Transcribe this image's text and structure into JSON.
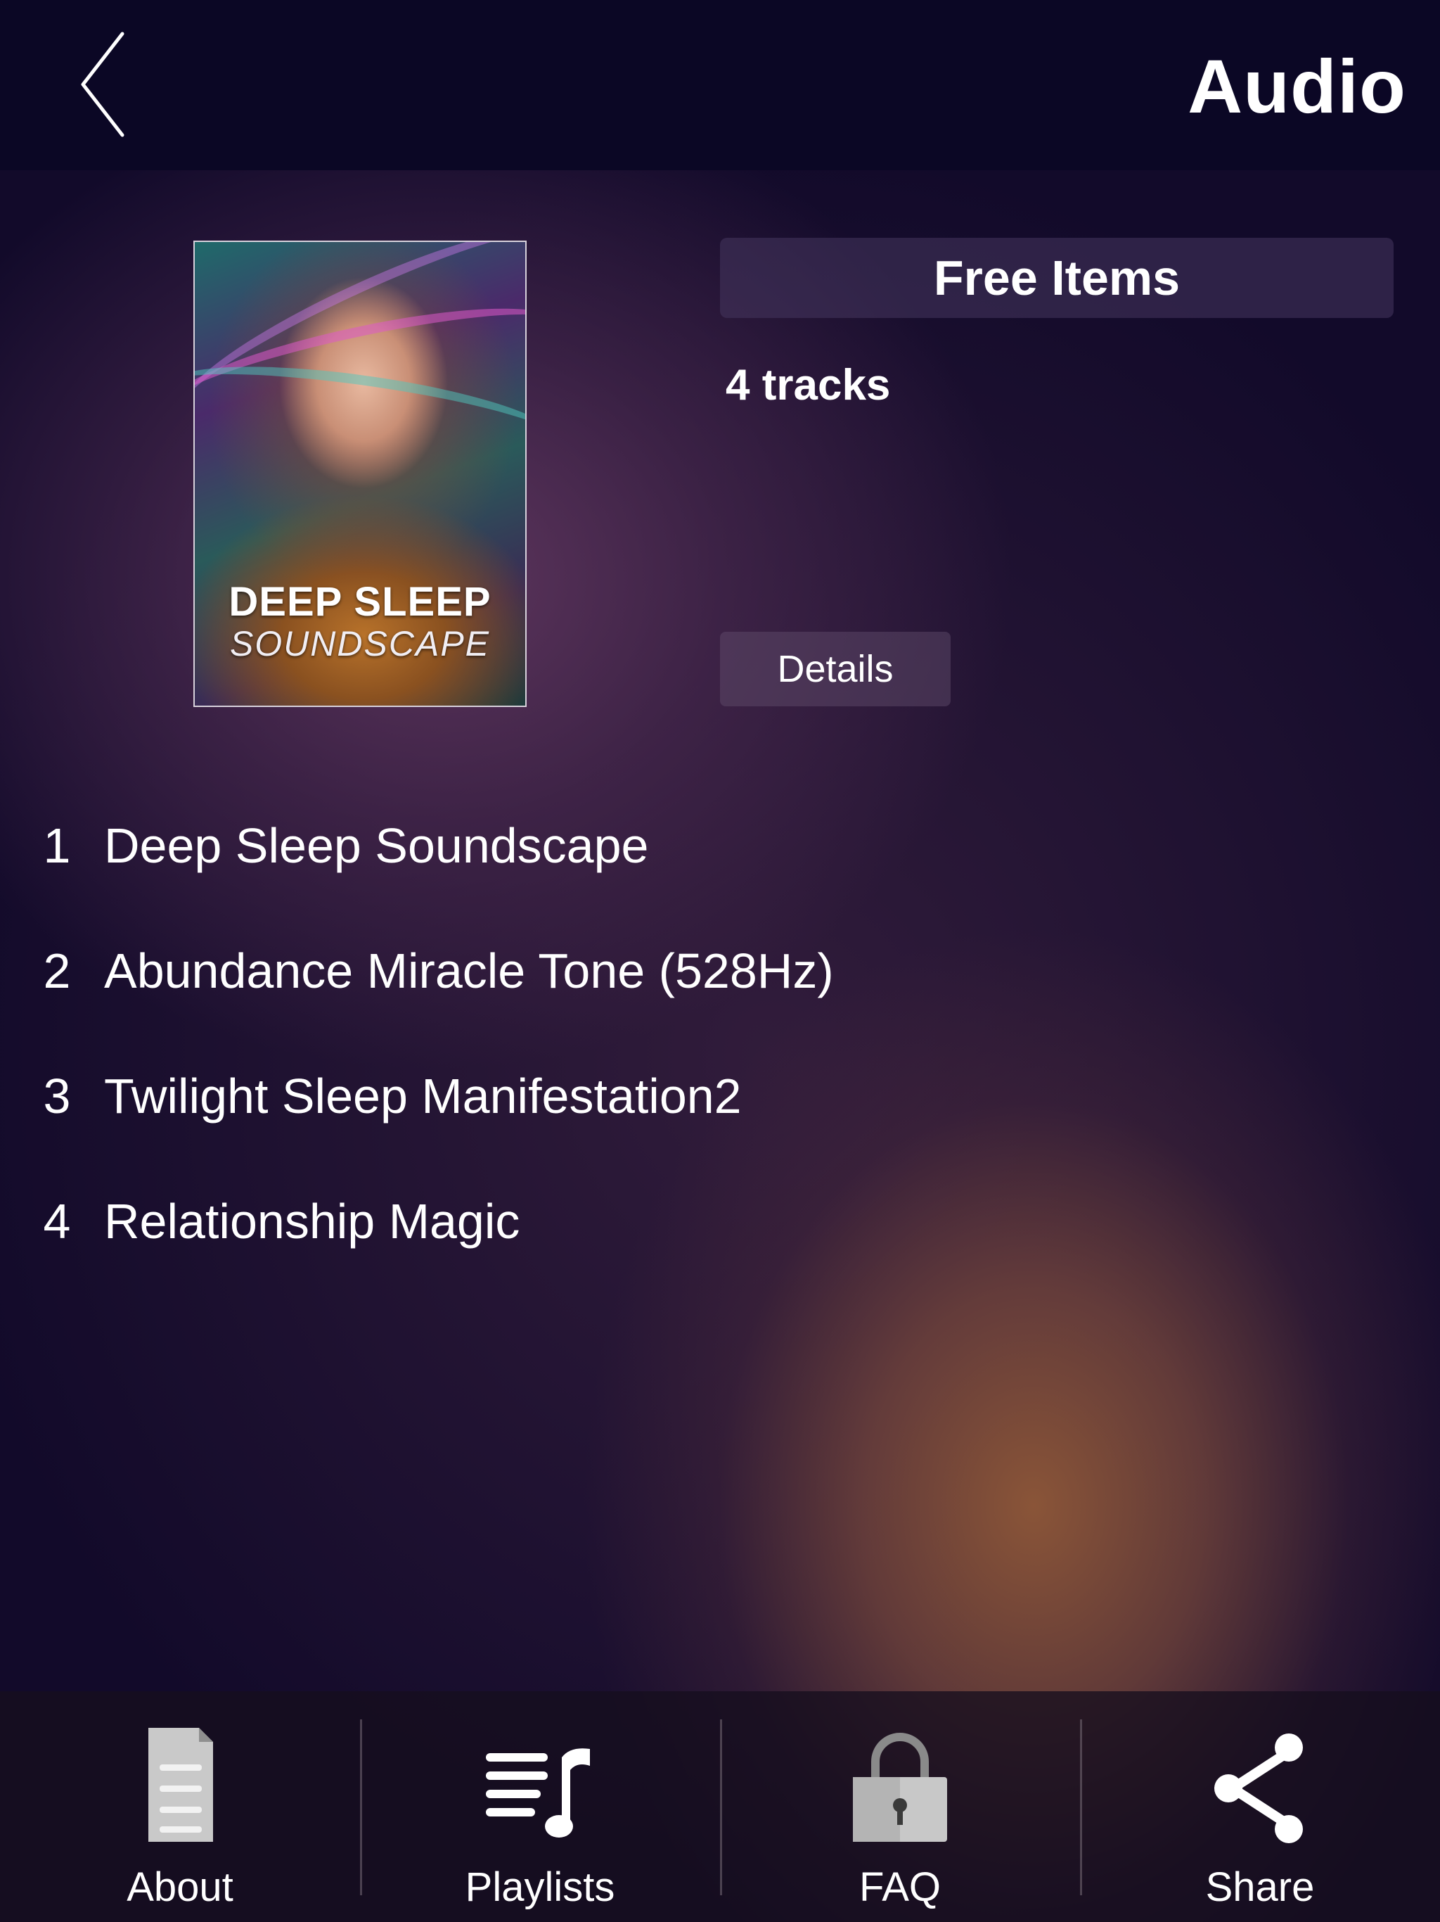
{
  "header": {
    "title": "Audio",
    "back_icon": "chevron-left-icon"
  },
  "album": {
    "art_title": "DEEP SLEEP",
    "art_subtitle": "SOUNDSCAPE",
    "category": "Free Items",
    "track_count": "4 tracks",
    "details_label": "Details"
  },
  "tracks": [
    {
      "number": "1",
      "title": "Deep Sleep Soundscape"
    },
    {
      "number": "2",
      "title": "Abundance Miracle Tone (528Hz)"
    },
    {
      "number": "3",
      "title": "Twilight Sleep Manifestation2"
    },
    {
      "number": "4",
      "title": "Relationship Magic"
    }
  ],
  "tab_bar": {
    "tabs": [
      {
        "label": "About",
        "icon": "document-icon"
      },
      {
        "label": "Playlists",
        "icon": "playlist-icon"
      },
      {
        "label": "FAQ",
        "icon": "lock-icon"
      },
      {
        "label": "Share",
        "icon": "share-icon"
      }
    ]
  },
  "colors": {
    "header_background": "#0b0725",
    "background": "#120a2a",
    "glow_orange": "#8c5638",
    "glow_purple": "#623860",
    "text": "#ffffff"
  }
}
